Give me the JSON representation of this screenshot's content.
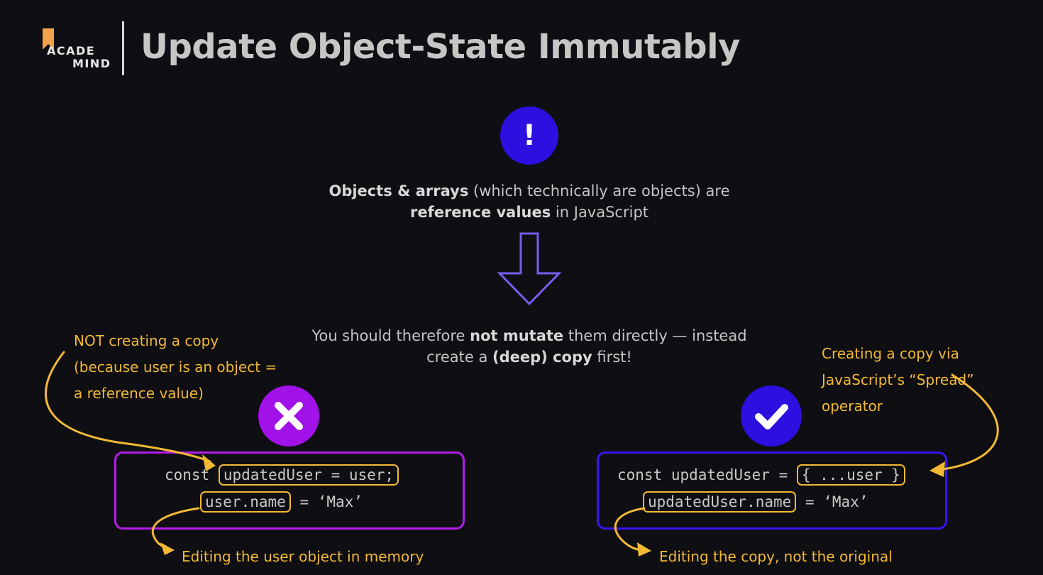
{
  "header": {
    "logo_line1": "ACADE",
    "logo_line2": "MIND",
    "title": "Update Object-State Immutably"
  },
  "alert": {
    "symbol": "!"
  },
  "statement": {
    "strong1": "Objects & arrays",
    "text1": " (which technically are objects) are",
    "strong2": "reference values",
    "text2": " in JavaScript"
  },
  "advice": {
    "text1": "You should therefore ",
    "strong1": "not mutate",
    "text2": " them directly — instead",
    "text3": "create a ",
    "strong2": "(deep) copy",
    "text4": " first!"
  },
  "bad_example": {
    "note": "NOT creating a copy (because user is an object = a reference value)",
    "line1_prefix": "const ",
    "line1_highlight": "updatedUser = user;",
    "line2_highlight": "user.name",
    "line2_suffix": " = ‘Max’",
    "caption": "Editing the user object in memory"
  },
  "good_example": {
    "note": "Creating a copy via JavaScript’s “Spread” operator",
    "line1_prefix": "const updatedUser = ",
    "line1_highlight": "{ ...user }",
    "line2_highlight": "updatedUser.name",
    "line2_suffix": " = ‘Max’",
    "caption": "Editing the copy, not the original"
  },
  "colors": {
    "background": "#0f0e12",
    "accent_blue": "#2c10e0",
    "accent_purple": "#a012e8",
    "annotation_yellow": "#f2b935",
    "arrow_outline": "#7a5cf0"
  }
}
